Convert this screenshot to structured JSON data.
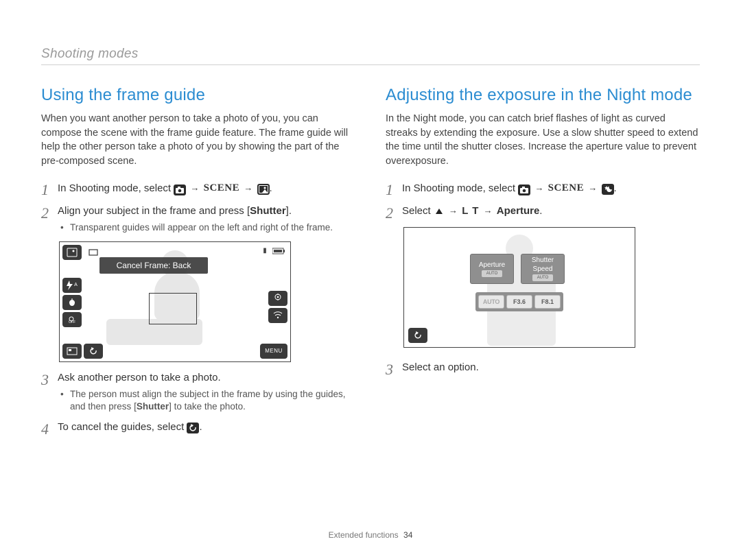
{
  "header": "Shooting modes",
  "left": {
    "title": "Using the frame guide",
    "intro": "When you want another person to take a photo of you, you can compose the scene with the frame guide feature. The frame guide will help the other person take a photo of you by showing the part of the pre-composed scene.",
    "steps": {
      "s1_a": "In Shooting mode, select ",
      "s1_scene": "SCENE",
      "s2_a": "Align your subject in the frame and press [",
      "s2_b": "Shutter",
      "s2_c": "].",
      "s2_sub": "Transparent guides will appear on the left and right of the frame.",
      "s3": "Ask another person to take a photo.",
      "s3_sub_a": "The person must align the subject in the frame by using the guides, and then press [",
      "s3_sub_b": "Shutter",
      "s3_sub_c": "] to take the photo.",
      "s4_a": "To cancel the guides, select "
    },
    "screenshot": {
      "banner": "Cancel Frame: Back",
      "menu_label": "MENU"
    }
  },
  "right": {
    "title": "Adjusting the exposure in the Night mode",
    "intro": "In the Night mode, you can catch brief flashes of light as curved streaks by extending the exposure. Use a slow shutter speed to extend the time until the shutter closes. Increase the aperture value to prevent overexposure.",
    "steps": {
      "s1_a": "In Shooting mode, select ",
      "s1_scene": "SCENE",
      "s2_a": "Select ",
      "s2_lt": "L T",
      "s2_b": "Aperture",
      "s3": "Select an option."
    },
    "screenshot": {
      "tab1": "Aperture",
      "tab2a": "Shutter",
      "tab2b": "Speed",
      "auto": "AUTO",
      "val1": "AUTO",
      "val2": "F3.6",
      "val3": "F8.1"
    }
  },
  "footer": {
    "section": "Extended functions",
    "page": "34"
  }
}
